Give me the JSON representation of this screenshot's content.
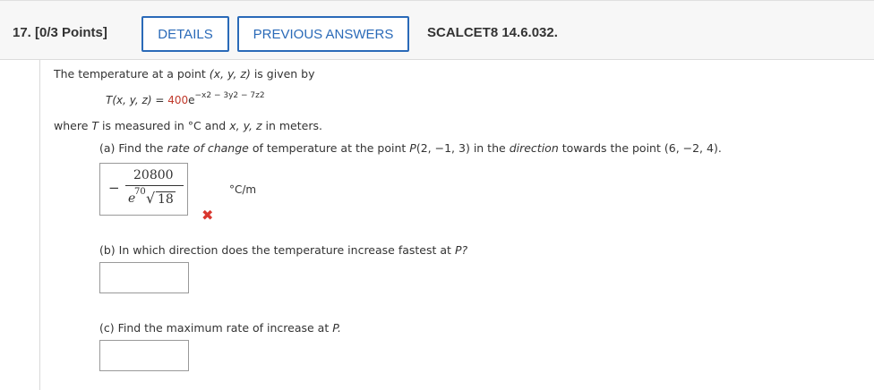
{
  "header": {
    "question_number": "17.",
    "points": "[0/3 Points]",
    "details_label": "DETAILS",
    "previous_answers_label": "PREVIOUS ANSWERS",
    "course_code": "SCALCET8 14.6.032."
  },
  "problem": {
    "intro": "The temperature at a point",
    "intro_vars": "(x, y, z)",
    "intro_end": "is given by",
    "function_lhs": "T(x, y, z) =",
    "function_coef": "400",
    "function_base": "e",
    "function_exponent": "−x2 − 3y2 − 7z2",
    "measure_where": "where",
    "measure_T": "T",
    "measure_mid": "is measured in °C and",
    "measure_vars": "x, y, z",
    "measure_end": "in meters."
  },
  "parts": {
    "a": {
      "prefix": "(a) Find the",
      "rate_text": "rate of change",
      "mid1": "of temperature at the point",
      "point_P": "P",
      "point_P_coords": "(2, −1, 3)",
      "mid2": "in the",
      "direction_text": "direction",
      "mid3": "towards the point",
      "target_point": "(6, −2, 4).",
      "answer_sign": "−",
      "answer_numerator": "20800",
      "answer_den_base": "e",
      "answer_den_exp": "70",
      "answer_den_sqrt": "√",
      "answer_den_radicand": "18",
      "units": "°C/m",
      "status_icon": "✖"
    },
    "b": {
      "label": "(b) In which direction does the temperature increase fastest at",
      "label_P": "P?",
      "answer": ""
    },
    "c": {
      "label": "(c) Find the maximum rate of increase at",
      "label_P": "P.",
      "answer": ""
    }
  },
  "colors": {
    "accent": "#2a6ab8",
    "error": "#d9372f",
    "coefficient": "#c0392b"
  }
}
